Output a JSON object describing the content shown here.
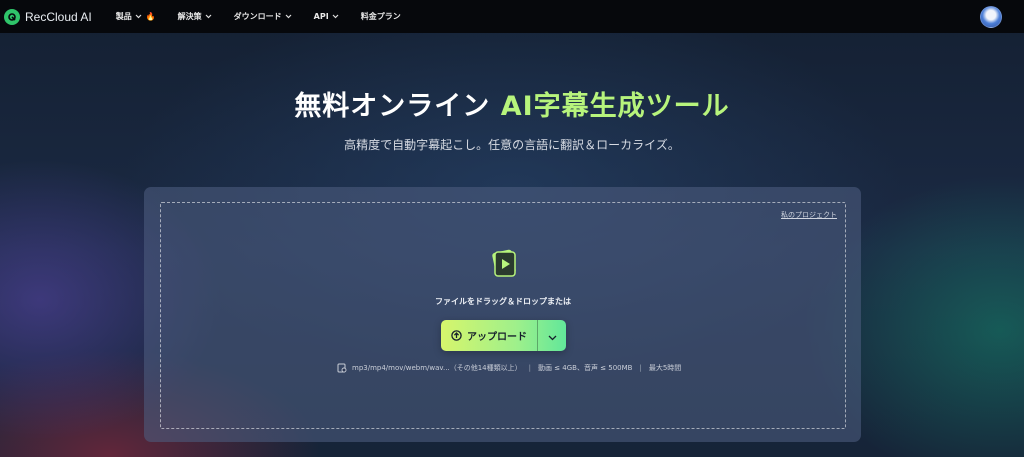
{
  "brand": {
    "name": "RecCloud AI"
  },
  "nav": {
    "items": [
      {
        "label": "製品",
        "has_chevron": true,
        "badge_icon": "fire-icon"
      },
      {
        "label": "解決策",
        "has_chevron": true
      },
      {
        "label": "ダウンロード",
        "has_chevron": true
      },
      {
        "label": "API",
        "has_chevron": true
      },
      {
        "label": "料金プラン",
        "has_chevron": false
      }
    ]
  },
  "hero": {
    "title_main": "無料オンライン ",
    "title_highlight": "AI字幕生成ツール",
    "subtitle": "高精度で自動字幕起こし。任意の言語に翻訳＆ローカライズ。"
  },
  "upload": {
    "my_projects_link": "私のプロジェクト",
    "drop_text": "ファイルをドラッグ＆ドロップまたは",
    "button_label": "アップロード",
    "formats": "mp3/mp4/mov/webm/wav...（その他14種類以上）",
    "size_limit": "動画 ≤ 4GB、音声 ≤ 500MB",
    "duration_limit": "最大5時間"
  },
  "colors": {
    "accent_green": "#b7f47c",
    "button_start": "#d6f56c",
    "button_end": "#62e79a",
    "brand_green": "#2fc46a"
  }
}
